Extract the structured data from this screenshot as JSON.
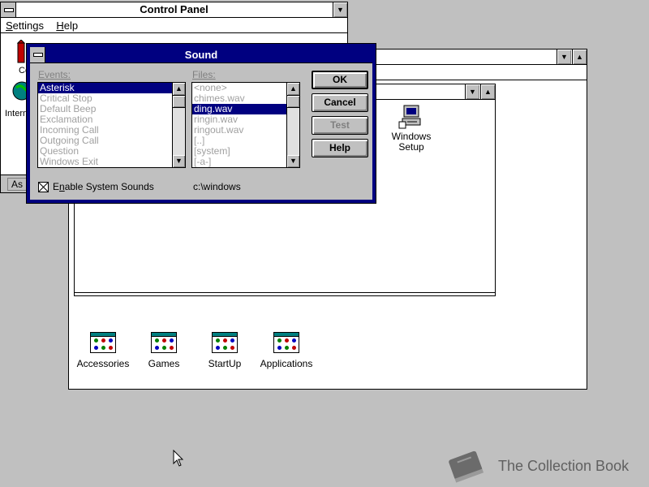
{
  "control_panel": {
    "title": "Control Panel",
    "menu": [
      {
        "label": "Settings",
        "key": "S",
        "rest": "ettings"
      },
      {
        "label": "Help",
        "key": "H",
        "rest": "elp"
      }
    ],
    "partial_icon_labels": [
      "Co",
      "Intern"
    ],
    "status_text": "As"
  },
  "program_manager": {
    "groups": [
      "Accessories",
      "Games",
      "StartUp",
      "Applications"
    ]
  },
  "inner_group": {
    "icon_label_line1": "Windows",
    "icon_label_line2": "Setup"
  },
  "sound_dialog": {
    "title": "Sound",
    "events_label": "Events:",
    "files_label": "Files:",
    "events": [
      "Asterisk",
      "Critical Stop",
      "Default Beep",
      "Exclamation",
      "Incoming Call",
      "Outgoing Call",
      "Question",
      "Windows Exit"
    ],
    "selected_event_index": 0,
    "files": [
      "<none>",
      "chimes.wav",
      "ding.wav",
      "ringin.wav",
      "ringout.wav",
      "[..]",
      "[system]",
      "[-a-]"
    ],
    "selected_file_index": 2,
    "buttons": {
      "ok": "OK",
      "cancel": "Cancel",
      "test": "Test",
      "help": "Help"
    },
    "enable_checkbox": {
      "label_pre": "E",
      "label_key": "n",
      "label_post": "able System Sounds",
      "checked": true
    },
    "directory": "c:\\windows"
  },
  "watermark": {
    "text": "The Collection Book"
  },
  "colors": {
    "desktop": "#c0c0c0",
    "active_title": "#000080",
    "window": "#ffffff"
  }
}
